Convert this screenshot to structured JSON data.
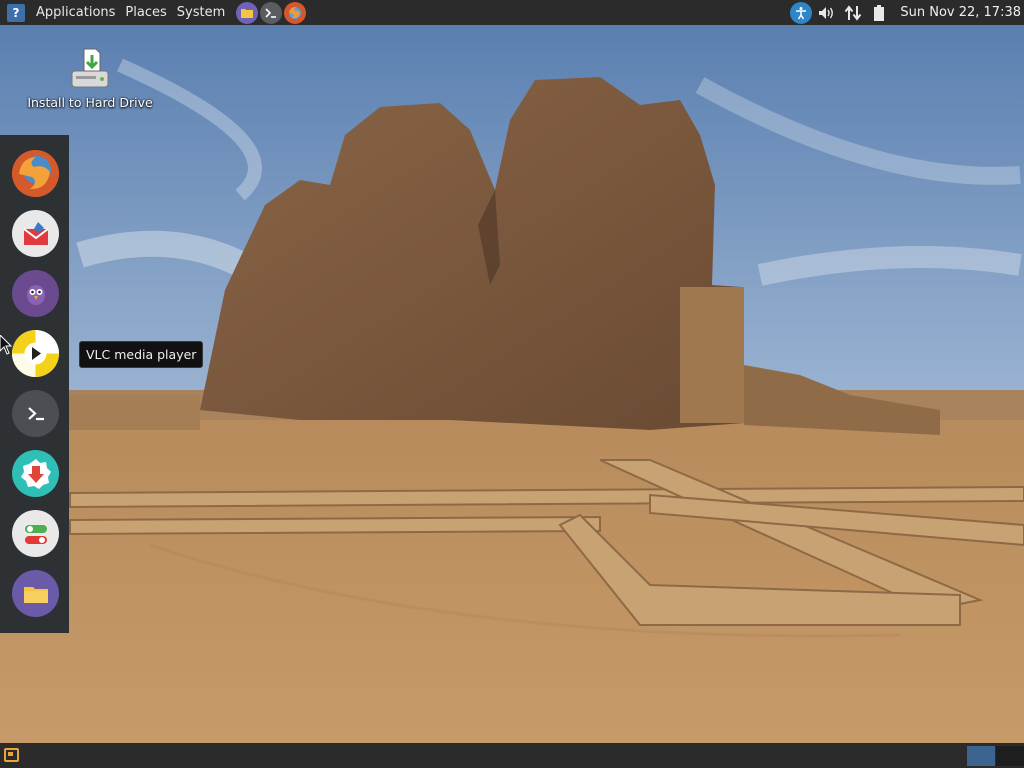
{
  "top_panel": {
    "menus": [
      "Applications",
      "Places",
      "System"
    ],
    "launchers": [
      {
        "name": "file-manager",
        "icon": "folder-icon"
      },
      {
        "name": "terminal",
        "icon": "terminal-icon"
      },
      {
        "name": "firefox",
        "icon": "firefox-icon"
      }
    ],
    "tray": {
      "icons": [
        "accessibility-icon",
        "volume-icon",
        "network-icon",
        "battery-icon"
      ],
      "clock": "Sun Nov 22, 17:38"
    }
  },
  "desktop": {
    "icons": [
      {
        "label": "Install to Hard Drive",
        "icon": "install-drive-icon"
      }
    ]
  },
  "dock": {
    "items": [
      {
        "name": "firefox",
        "icon": "firefox-icon",
        "color": "#d55a2b"
      },
      {
        "name": "mail",
        "icon": "mail-icon",
        "color": "#e9e9e9"
      },
      {
        "name": "pidgin",
        "icon": "pidgin-icon",
        "color": "#6b4a8f"
      },
      {
        "name": "vlc",
        "icon": "vlc-icon",
        "color": "#f4d21a"
      },
      {
        "name": "terminal",
        "icon": "terminal-icon",
        "color": "#4b4e52"
      },
      {
        "name": "software-updater",
        "icon": "update-icon",
        "color": "#2fbfb6"
      },
      {
        "name": "settings-toggles",
        "icon": "toggles-icon",
        "color": "#e9e9e9"
      },
      {
        "name": "files",
        "icon": "folder-icon",
        "color": "#6b5aa8"
      }
    ]
  },
  "tooltip": {
    "text": "VLC media player"
  },
  "bottom_panel": {
    "show_desktop_icon": "show-desktop-icon",
    "workspaces": [
      "workspace-1",
      "workspace-2"
    ],
    "active_workspace_color": "#3d6491"
  }
}
